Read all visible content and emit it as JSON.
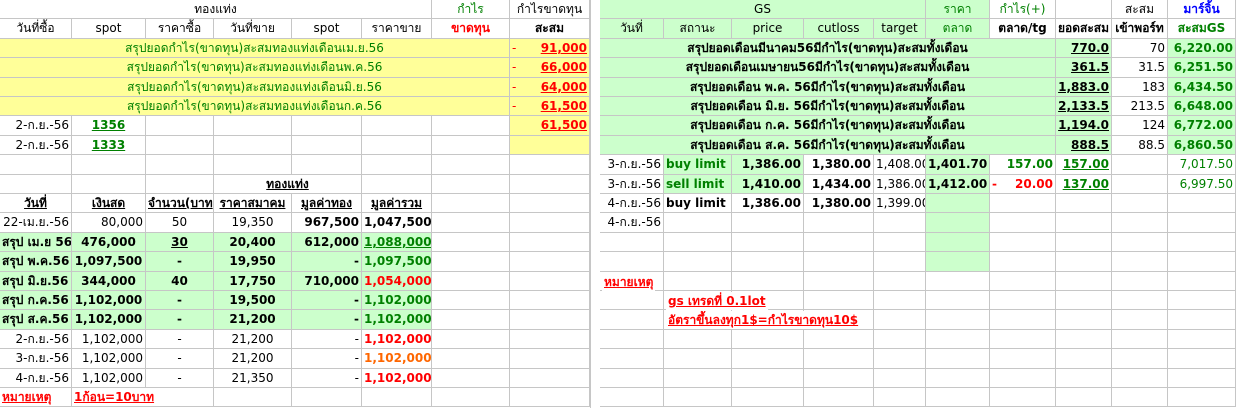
{
  "left": {
    "title_top": "ทองแท่ง",
    "profit_label": "กำไร",
    "profit_loss_cum_label": "กำไรขาดทุน",
    "headers": [
      "วันที่ซื้อ",
      "spot",
      "ราคาซื้อ",
      "วันที่ขาย",
      "spot",
      "ราคาขาย",
      "ขาดทุน",
      "สะสม"
    ],
    "summary_rows": [
      {
        "label": "สรุปยอดกำไร(ขาดทุน)สะสมทองแท่งเดือนเม.ย.56",
        "sign": "-",
        "value": "91,000"
      },
      {
        "label": "สรุปยอดกำไร(ขาดทุน)สะสมทองแท่งเดือนพ.ค.56",
        "sign": "-",
        "value": "66,000"
      },
      {
        "label": "สรุปยอดกำไร(ขาดทุน)สะสมทองแท่งเดือนมิ.ย.56",
        "sign": "-",
        "value": "64,000"
      },
      {
        "label": "สรุปยอดกำไร(ขาดทุน)สะสมทองแท่งเดือนก.ค.56",
        "sign": "-",
        "value": "61,500"
      }
    ],
    "trade_rows": [
      {
        "date": "2-ก.ย.-56",
        "spot": "1356",
        "cum": "61,500"
      },
      {
        "date": "2-ก.ย.-56",
        "spot": "1333",
        "cum": ""
      }
    ],
    "bar_title": "ทองแท่ง",
    "table_headers": [
      "วันที่",
      "เงินสด",
      "จำนวน(บาท",
      "ราคาสมาคม",
      "มูลค่าทอง",
      "มูลค่ารวม"
    ],
    "table_rows": [
      {
        "date": "22-เม.ย.-56",
        "cash": "80,000",
        "qty": "50",
        "price": "19,350",
        "gold": "967,500",
        "total": "1,047,500",
        "style": "plain"
      },
      {
        "date": "สรุป เม.ย 56",
        "cash": "476,000",
        "qty": "30",
        "price": "20,400",
        "gold": "612,000",
        "total": "1,088,000",
        "style": "green"
      },
      {
        "date": "สรุป พ.ค.56",
        "cash": "1,097,500",
        "qty": "-",
        "price": "19,950",
        "gold": "-",
        "total": "1,097,500",
        "style": "green"
      },
      {
        "date": "สรุป มิ.ย.56",
        "cash": "344,000",
        "qty": "40",
        "price": "17,750",
        "gold": "710,000",
        "total": "1,054,000",
        "style": "greenred"
      },
      {
        "date": "สรุป ก.ค.56",
        "cash": "1,102,000",
        "qty": "-",
        "price": "19,500",
        "gold": "-",
        "total": "1,102,000",
        "style": "green"
      },
      {
        "date": "สรุป ส.ค.56",
        "cash": "1,102,000",
        "qty": "-",
        "price": "21,200",
        "gold": "-",
        "total": "1,102,000",
        "style": "green"
      },
      {
        "date": "2-ก.ย.-56",
        "cash": "1,102,000",
        "qty": "-",
        "price": "21,200",
        "gold": "-",
        "total": "1,102,000",
        "style": "red"
      },
      {
        "date": "3-ก.ย.-56",
        "cash": "1,102,000",
        "qty": "-",
        "price": "21,200",
        "gold": "-",
        "total": "1,102,000",
        "style": "orange"
      },
      {
        "date": "4-ก.ย.-56",
        "cash": "1,102,000",
        "qty": "-",
        "price": "21,350",
        "gold": "-",
        "total": "1,102,000",
        "style": "red"
      }
    ],
    "note_label": "หมายเหตุ",
    "note_text": "1ก้อน=10บาท"
  },
  "right": {
    "gs_label": "GS",
    "price_label": "ราคา",
    "profit_plus_label": "กำไร(+)",
    "cum_label": "สะสม",
    "margin_label": "มาร์จิ้น",
    "headers": [
      "วันที่",
      "สถานะ",
      "price",
      "cutloss",
      "target",
      "ตลาด",
      "ตลาด/tg",
      "ยอดสะสม",
      "เข้าพอร์ท",
      "สะสมGS"
    ],
    "summary_rows": [
      {
        "label": "สรุปยอดเดือนมีนาคม56มีกำไร(ขาดทุน)สะสมทั้งเดือน",
        "cum": "770.0",
        "port": "70",
        "gs": "6,220.00"
      },
      {
        "label": "สรุปยอดเดือนเมษายน56มีกำไร(ขาดทุน)สะสมทั้งเดือน",
        "cum": "361.5",
        "port": "31.5",
        "gs": "6,251.50"
      },
      {
        "label": "สรุปยอดเดือน พ.ค. 56มีกำไร(ขาดทุน)สะสมทั้งเดือน",
        "cum": "1,883.0",
        "port": "183",
        "gs": "6,434.50"
      },
      {
        "label": "สรุปยอดเดือน มิ.ย. 56มีกำไร(ขาดทุน)สะสมทั้งเดือน",
        "cum": "2,133.5",
        "port": "213.5",
        "gs": "6,648.00"
      },
      {
        "label": "สรุปยอดเดือน ก.ค. 56มีกำไร(ขาดทุน)สะสมทั้งเดือน",
        "cum": "1,194.0",
        "port": "124",
        "gs": "6,772.00"
      },
      {
        "label": "สรุปยอดเดือน ส.ค. 56มีกำไร(ขาดทุน)สะสมทั้งเดือน",
        "cum": "888.5",
        "port": "88.5",
        "gs": "6,860.50"
      }
    ],
    "trade_rows": [
      {
        "date": "3-ก.ย.-56",
        "status": "buy limit",
        "price": "1,386.00",
        "cutloss": "1,380.00",
        "target": "1,408.00",
        "market": "1,401.70",
        "tg": "157.00",
        "tgsign": "",
        "cum": "157.00",
        "port": "",
        "gs": "7,017.50"
      },
      {
        "date": "3-ก.ย.-56",
        "status": "sell limit",
        "price": "1,410.00",
        "cutloss": "1,434.00",
        "target": "1,386.00",
        "market": "1,412.00",
        "tg": "20.00",
        "tgsign": "-",
        "cum": "137.00",
        "port": "",
        "gs": "6,997.50"
      },
      {
        "date": "4-ก.ย.-56",
        "status": "buy limit",
        "price": "1,386.00",
        "cutloss": "1,380.00",
        "target": "1,399.00",
        "market": "",
        "tg": "",
        "tgsign": "",
        "cum": "",
        "port": "",
        "gs": ""
      },
      {
        "date": "4-ก.ย.-56",
        "status": "",
        "price": "",
        "cutloss": "",
        "target": "",
        "market": "",
        "tg": "",
        "tgsign": "",
        "cum": "",
        "port": "",
        "gs": ""
      }
    ],
    "note_label": "หมายเหตุ",
    "note_1": "gs เทรดที่ 0.1lot",
    "note_2": "อัตราขึ้นลงทุก1$=กำไรขาดทุน10$"
  },
  "colors": {
    "yellow": "#ffff99",
    "green": "#ccffcc",
    "red": "#ff0000",
    "orange": "#ff6600",
    "darkgreen": "#008000"
  }
}
